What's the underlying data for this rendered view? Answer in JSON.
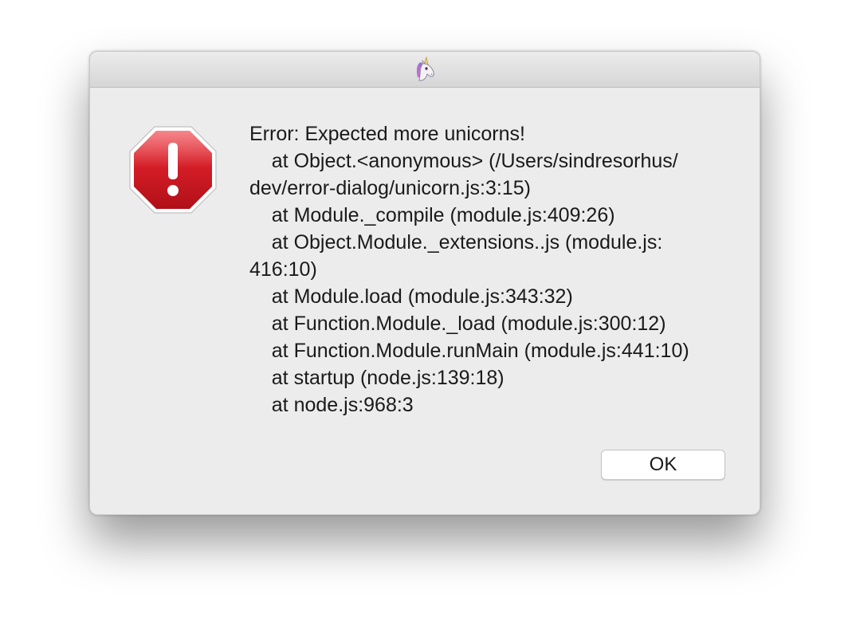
{
  "window": {
    "title_icon": "unicorn-icon"
  },
  "dialog": {
    "alert_icon": "stop-sign-exclamation-icon",
    "message_lines": [
      "Error: Expected more unicorns!",
      "    at Object.<anonymous> (/Users/sindresorhus/",
      "dev/error-dialog/unicorn.js:3:15)",
      "    at Module._compile (module.js:409:26)",
      "    at Object.Module._extensions..js (module.js:",
      "416:10)",
      "    at Module.load (module.js:343:32)",
      "    at Function.Module._load (module.js:300:12)",
      "    at Function.Module.runMain (module.js:441:10)",
      "    at startup (node.js:139:18)",
      "    at node.js:968:3"
    ],
    "ok_label": "OK"
  },
  "colors": {
    "alert_red": "#d0202a",
    "dialog_bg": "#ececec"
  }
}
